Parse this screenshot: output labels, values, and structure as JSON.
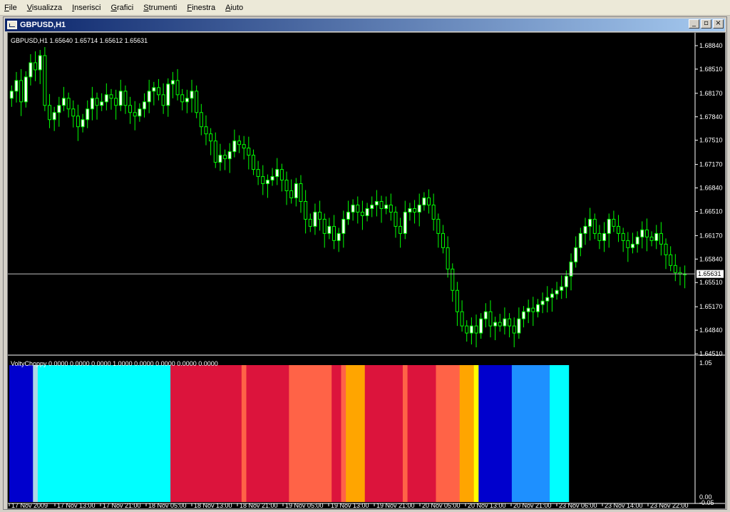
{
  "menu": [
    "File",
    "Visualizza",
    "Inserisci",
    "Grafici",
    "Strumenti",
    "Finestra",
    "Aiuto"
  ],
  "window": {
    "title": "GBPUSD,H1"
  },
  "colors": {
    "bull": "#ffffff",
    "bear": "#000000",
    "wick": "#00ff00",
    "price_line": "#c0c0c0",
    "axis": "#ffffff",
    "background": "#000000"
  },
  "chart_data": [
    {
      "type": "candlestick",
      "title": "GBPUSD,H1  1.65640 1.65714 1.65612 1.65631",
      "ylim": [
        1.6451,
        1.6884
      ],
      "yticks": [
        "1.68840",
        "1.68510",
        "1.68170",
        "1.67840",
        "1.67510",
        "1.67170",
        "1.66840",
        "1.66510",
        "1.66170",
        "1.65840",
        "1.65510",
        "1.65170",
        "1.64840",
        "1.64510"
      ],
      "current_price": "1.65631",
      "close_series": [
        1.682,
        1.6835,
        1.6805,
        1.684,
        1.686,
        1.685,
        1.687,
        1.68,
        1.678,
        1.679,
        1.68,
        1.681,
        1.6795,
        1.6785,
        1.677,
        1.678,
        1.6795,
        1.681,
        1.68,
        1.6805,
        1.6815,
        1.681,
        1.68,
        1.682,
        1.68,
        1.679,
        1.6785,
        1.6795,
        1.6805,
        1.682,
        1.6825,
        1.6815,
        1.68,
        1.683,
        1.6835,
        1.6815,
        1.6805,
        1.681,
        1.682,
        1.679,
        1.677,
        1.676,
        1.675,
        1.672,
        1.673,
        1.6725,
        1.6735,
        1.675,
        1.6745,
        1.674,
        1.673,
        1.671,
        1.67,
        1.669,
        1.6695,
        1.67,
        1.671,
        1.6695,
        1.668,
        1.667,
        1.669,
        1.6665,
        1.664,
        1.663,
        1.665,
        1.664,
        1.662,
        1.663,
        1.661,
        1.662,
        1.664,
        1.665,
        1.666,
        1.665,
        1.6645,
        1.6655,
        1.666,
        1.6665,
        1.6655,
        1.666,
        1.665,
        1.663,
        1.662,
        1.665,
        1.6655,
        1.665,
        1.666,
        1.667,
        1.666,
        1.664,
        1.662,
        1.66,
        1.657,
        1.654,
        1.651,
        1.649,
        1.648,
        1.649,
        1.648,
        1.65,
        1.651,
        1.649,
        1.6495,
        1.649,
        1.65,
        1.649,
        1.648,
        1.65,
        1.651,
        1.6515,
        1.651,
        1.652,
        1.6525,
        1.653,
        1.6535,
        1.654,
        1.6545,
        1.656,
        1.658,
        1.66,
        1.662,
        1.663,
        1.664,
        1.662,
        1.661,
        1.662,
        1.664,
        1.663,
        1.662,
        1.661,
        1.66,
        1.6605,
        1.6615,
        1.6625,
        1.6615,
        1.661,
        1.662,
        1.6605,
        1.659,
        1.6575,
        1.6565,
        1.6563,
        1.6563
      ]
    },
    {
      "type": "heatmap",
      "title": "VoltyChoppy 0.0000 0.0000 0.0000 1.0000 0.0000 0.0000 0.0000 0.0000",
      "ylim": [
        -0.05,
        1.05
      ],
      "yticks": [
        "1.05",
        "0.00",
        "-0.05"
      ],
      "segments": [
        {
          "color": "#0000cd",
          "bars": 5
        },
        {
          "color": "#add8e6",
          "bars": 1
        },
        {
          "color": "#00ffff",
          "bars": 28
        },
        {
          "color": "#dc143c",
          "bars": 15
        },
        {
          "color": "#ff6347",
          "bars": 1
        },
        {
          "color": "#dc143c",
          "bars": 9
        },
        {
          "color": "#ff6347",
          "bars": 9
        },
        {
          "color": "#dc143c",
          "bars": 2
        },
        {
          "color": "#ff6347",
          "bars": 1
        },
        {
          "color": "#ffa500",
          "bars": 4
        },
        {
          "color": "#dc143c",
          "bars": 8
        },
        {
          "color": "#ff6347",
          "bars": 1
        },
        {
          "color": "#dc143c",
          "bars": 6
        },
        {
          "color": "#ff6347",
          "bars": 5
        },
        {
          "color": "#ffa500",
          "bars": 3
        },
        {
          "color": "#ffff00",
          "bars": 1
        },
        {
          "color": "#0000cd",
          "bars": 7
        },
        {
          "color": "#1e90ff",
          "bars": 8
        },
        {
          "color": "#00ffff",
          "bars": 4
        }
      ]
    }
  ],
  "time_labels": [
    "17 Nov 2009",
    "17 Nov 13:00",
    "17 Nov 21:00",
    "18 Nov 05:00",
    "18 Nov 13:00",
    "18 Nov 21:00",
    "19 Nov 05:00",
    "19 Nov 13:00",
    "19 Nov 21:00",
    "20 Nov 05:00",
    "20 Nov 13:00",
    "20 Nov 21:00",
    "23 Nov 06:00",
    "23 Nov 14:00",
    "23 Nov 22:00"
  ]
}
